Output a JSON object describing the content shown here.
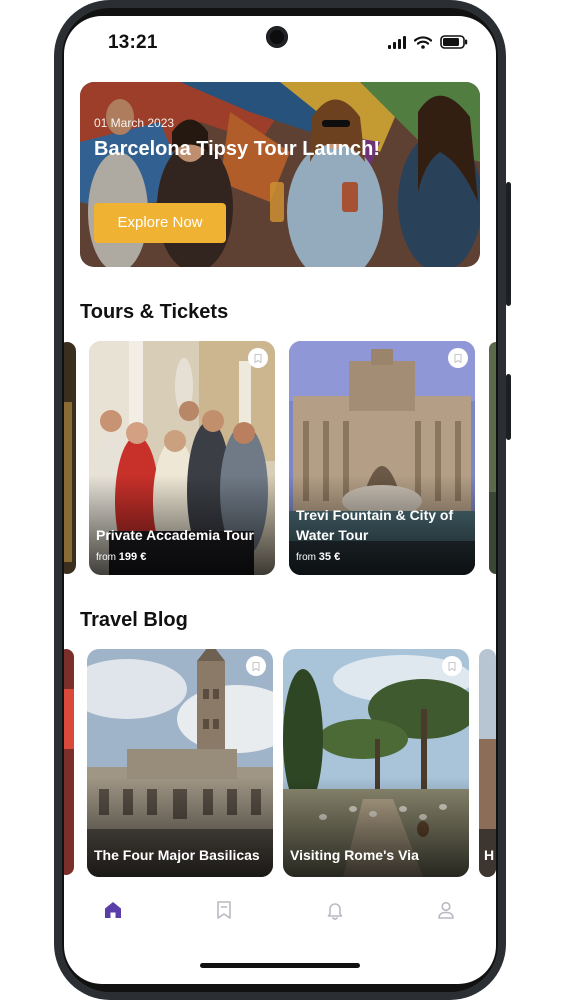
{
  "status_bar": {
    "time": "13:21"
  },
  "hero": {
    "date": "01 March 2023",
    "title": "Barcelona Tipsy Tour Launch!",
    "cta_label": "Explore Now"
  },
  "tours": {
    "title": "Tours & Tickets",
    "items": [
      {
        "title": "Private Accademia Tour",
        "price_prefix": "from",
        "price": "199 €"
      },
      {
        "title": "Trevi Fountain & City of Water Tour",
        "price_prefix": "from",
        "price": "35 €"
      }
    ]
  },
  "blog": {
    "title": "Travel Blog",
    "items": [
      {
        "title": "The Four Major Basilicas"
      },
      {
        "title": "Visiting Rome's Via"
      },
      {
        "title": "H"
      }
    ]
  },
  "nav": {
    "items": [
      "home-icon",
      "bookmark-icon",
      "bell-icon",
      "user-icon"
    ],
    "active_color": "#5b3fa8",
    "inactive_color": "#b9b9c2"
  },
  "colors": {
    "accent": "#f0b233"
  }
}
